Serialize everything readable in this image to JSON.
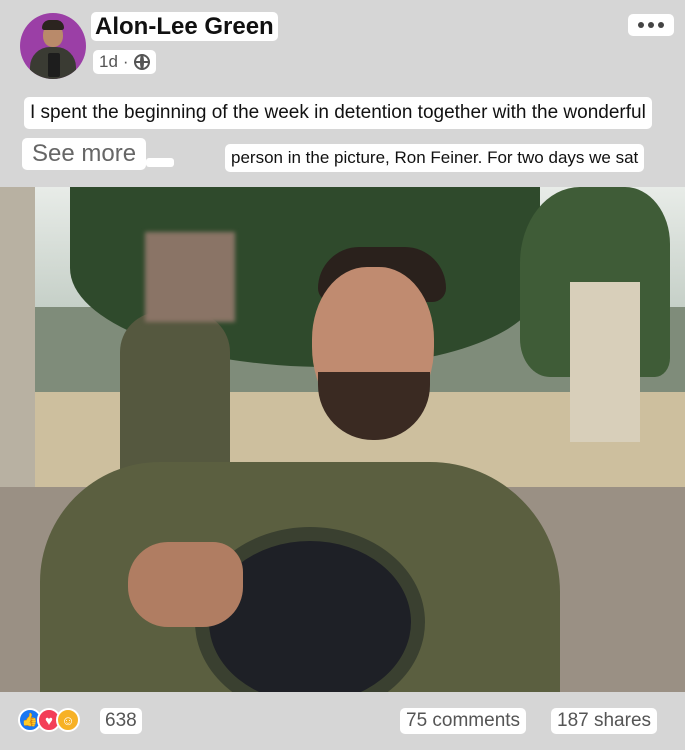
{
  "post": {
    "author": "Alon-Lee Green",
    "time": "1d",
    "separator": "·",
    "privacy_icon": "globe-icon",
    "more_icon": "more-options-icon",
    "text_line1": "I spent the beginning of the week in detention together with the wonderful",
    "see_more": "See more",
    "tiny_label": "",
    "text_line2": "person in the picture, Ron Feiner. For two days we sat"
  },
  "reactions": {
    "icons": [
      "like-icon",
      "love-icon",
      "care-icon"
    ],
    "count": "638",
    "comments": "75 comments",
    "shares": "187 shares"
  },
  "colors": {
    "like": "#1877f2",
    "love": "#f33e58",
    "care": "#f7b125",
    "avatar_bg": "#9b3fa6"
  }
}
